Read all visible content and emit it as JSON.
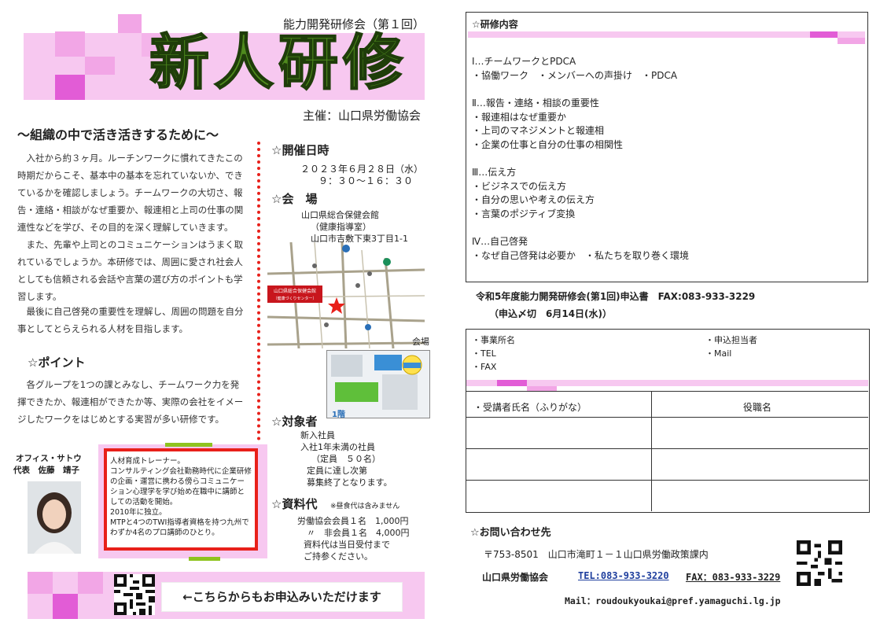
{
  "header": {
    "subtitle": "能力開発研修会（第１回）",
    "title": "新人研修",
    "organizer": "主催：山口県労働協会"
  },
  "intro": {
    "heading": "～組織の中で活き活きするために～",
    "p1": "入社から約３ヶ月。ルーチンワークに慣れてきたこの時期だからこそ、基本中の基本を忘れていないか、できているかを確認しましょう。チームワークの大切さ、報告・連絡・相談がなぜ重要か、報連相と上司の仕事の関連性などを学び、その目的を深く理解していきます。",
    "p2": "また、先輩や上司とのコミュニケーションはうまく取れているでしょうか。本研修では、周囲に愛され社会人としても信頼される会話や言葉の選び方のポイントも学習します。",
    "p3": "最後に自己啓発の重要性を理解し、周囲の問題を自分事としてとらえられる人材を目指します。"
  },
  "point": {
    "heading": "☆ポイント",
    "text": "各グループを1つの課とみなし、チームワーク力を発揮できたか、報連相ができたか等、実際の会社をイメージしたワークをはじめとする実習が多い研修です。"
  },
  "instructor": {
    "org": "オフィス・サトウ",
    "name": "代表　佐藤　靖子",
    "bio": [
      "人材育成トレーナー。",
      "コンサルティング会社勤務時代に企業研修の企画・運営に携わる傍らコミュニケーション心理学を学び始め在職中に講師としての活動を開始。",
      "2010年に独立。",
      "MTPと4つのTWI指導者資格を持つ九州でわずか4名のプロ講師のひとり。"
    ]
  },
  "schedule": {
    "heading": "☆開催日時",
    "date": "２０２３年６月２８日（水）",
    "time": "９：３０～１６：３０"
  },
  "venue": {
    "heading": "☆会　場",
    "name": "山口県総合保健会館",
    "room": "（健康指導室）",
    "address": "山口市吉敷下東3丁目1-1",
    "map_label_main": "山口県総合保健会館",
    "map_label_sub": "（健康づくりセンター）",
    "floor_label": "会場",
    "floor": "1階"
  },
  "target": {
    "heading": "☆対象者",
    "lines": [
      "新入社員",
      "入社1年未満の社員",
      "（定員　５０名）",
      "定員に達し次第",
      "募集終了となります。"
    ]
  },
  "fee": {
    "heading": "☆資料代",
    "note": "※昼食代は含みません",
    "lines": [
      "労働協会会員１名　1,000円",
      "〃　非会員１名　4,000円",
      "資料代は当日受付まで",
      "ご持参ください。"
    ]
  },
  "apply_note": "←こちらからもお申込みいただけます",
  "content": {
    "heading": "☆研修内容",
    "sections": [
      {
        "title": "Ⅰ…チームワークとPDCA",
        "items": [
          "・協働ワーク　・メンバーへの声掛け　・PDCA"
        ]
      },
      {
        "title": "Ⅱ…報告・連絡・相談の重要性",
        "items": [
          "・報連相はなぜ重要か",
          "・上司のマネジメントと報連相",
          "・企業の仕事と自分の仕事の相関性"
        ]
      },
      {
        "title": "Ⅲ…伝え方",
        "items": [
          "・ビジネスでの伝え方",
          "・自分の思いや考えの伝え方",
          "・言葉のポジティブ変換"
        ]
      },
      {
        "title": "Ⅳ…自己啓発",
        "items": [
          "・なぜ自己啓発は必要か　・私たちを取り巻く環境"
        ]
      }
    ]
  },
  "form": {
    "title": "令和5年度能力開発研修会(第1回)申込書　FAX:083-933-3229",
    "deadline": "（申込〆切　6月14日(水)）",
    "company": "・事業所名",
    "tel": "・TEL",
    "fax": "・FAX",
    "contact_person": "・申込担当者",
    "mail": "・Mail",
    "col_name": "・受講者氏名（ふりがな）",
    "col_title": "役職名"
  },
  "inquiry": {
    "heading": "☆お問い合わせ先",
    "address": "〒753-8501　山口市滝町１－１山口県労働政策課内",
    "org": "山口県労働協会",
    "tel": "TEL:083-933-3220",
    "fax": "FAX：083-933-3229",
    "mail": "Mail：roudoukyoukai@pref.yamaguchi.lg.jp"
  },
  "colors": {
    "title_green": "#4f8a1e",
    "pink": "#f7c8f0",
    "magenta": "#e25cd6",
    "red": "#e8201a"
  }
}
